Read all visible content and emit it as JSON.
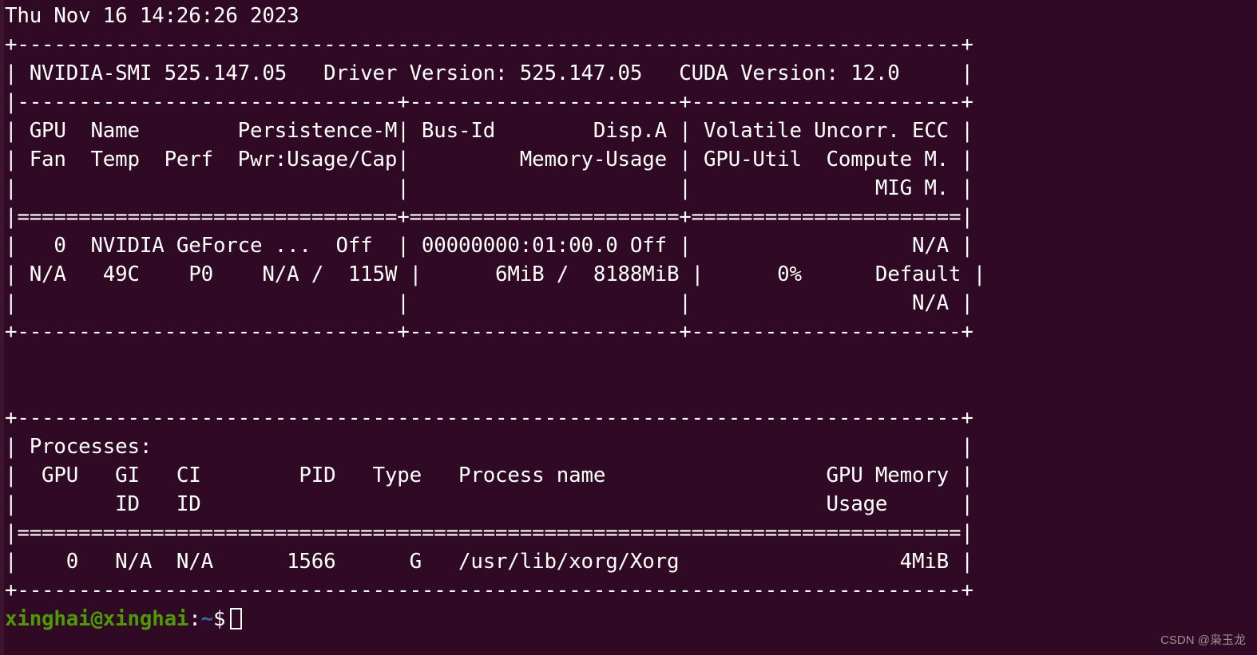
{
  "terminal": {
    "background_color": "#300a24",
    "foreground_color": "#ffffff",
    "timestamp_line": "Thu Nov 16 14:26:26 2023",
    "smi_table": {
      "border_top": "+-----------------------------------------------------------------------------+",
      "header_line": "| NVIDIA-SMI 525.147.05   Driver Version: 525.147.05   CUDA Version: 12.0     |",
      "border_mid": "|-------------------------------+----------------------+----------------------+",
      "col_header_1": "| GPU  Name        Persistence-M| Bus-Id        Disp.A | Volatile Uncorr. ECC |",
      "col_header_2": "| Fan  Temp  Perf  Pwr:Usage/Cap|         Memory-Usage | GPU-Util  Compute M. |",
      "col_header_3": "|                               |                      |               MIG M. |",
      "border_eq": "|===============================+======================+======================|",
      "gpu_row_1": "|   0  NVIDIA GeForce ...  Off  | 00000000:01:00.0 Off |                  N/A |",
      "gpu_row_2": "| N/A   49C    P0    N/A /  115W |      6MiB /  8188MiB |      0%      Default |",
      "gpu_row_3": "|                               |                      |                  N/A |",
      "border_bottom": "+-------------------------------+----------------------+----------------------+",
      "nvidia_smi_version": "525.147.05",
      "driver_version": "525.147.05",
      "cuda_version": "12.0",
      "columns": [
        "GPU",
        "Name",
        "Persistence-M",
        "Bus-Id",
        "Disp.A",
        "Volatile Uncorr. ECC",
        "Fan",
        "Temp",
        "Perf",
        "Pwr:Usage/Cap",
        "Memory-Usage",
        "GPU-Util",
        "Compute M.",
        "MIG M."
      ],
      "gpus": [
        {
          "index": "0",
          "name": "NVIDIA GeForce ...",
          "persistence_m": "Off",
          "bus_id": "00000000:01:00.0",
          "disp_a": "Off",
          "ecc": "N/A",
          "fan": "N/A",
          "temp": "49C",
          "perf": "P0",
          "pwr_usage_cap": "N/A /  115W",
          "memory_usage": "6MiB /  8188MiB",
          "gpu_util": "0%",
          "compute_m": "Default",
          "mig_m": "N/A"
        }
      ]
    },
    "processes_table": {
      "border_top": "+-----------------------------------------------------------------------------+",
      "title_line": "| Processes:                                                                  |",
      "col_header_1": "|  GPU   GI   CI        PID   Type   Process name                  GPU Memory |",
      "col_header_2": "|        ID   ID                                                   Usage      |",
      "border_eq": "|=============================================================================|",
      "proc_row_1": "|    0   N/A  N/A      1566      G   /usr/lib/xorg/Xorg                  4MiB |",
      "border_bottom": "+-----------------------------------------------------------------------------+",
      "title": "Processes:",
      "columns": [
        "GPU",
        "GI ID",
        "CI ID",
        "PID",
        "Type",
        "Process name",
        "GPU Memory Usage"
      ],
      "rows": [
        {
          "gpu": "0",
          "gi_id": "N/A",
          "ci_id": "N/A",
          "pid": "1566",
          "type": "G",
          "process_name": "/usr/lib/xorg/Xorg",
          "gpu_memory_usage": "4MiB"
        }
      ]
    },
    "prompt": {
      "user_host": "xinghai@xinghai",
      "separator": ":",
      "path": "~",
      "symbol": "$",
      "command": "",
      "user_color": "#4e9a06",
      "path_color": "#3465a4"
    }
  },
  "watermark": {
    "text": "CSDN @枭玉龙"
  }
}
